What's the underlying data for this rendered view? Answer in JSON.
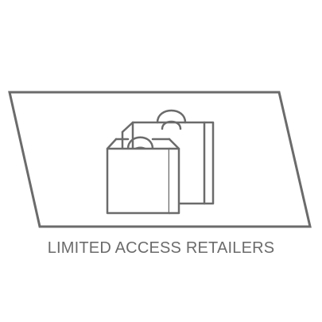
{
  "caption": "LIMITED ACCESS RETAILERS",
  "icon": "shopping-bags-icon",
  "colors": {
    "stroke": "#6b6b6b",
    "background": "#ffffff",
    "text": "#6b6b6b"
  }
}
